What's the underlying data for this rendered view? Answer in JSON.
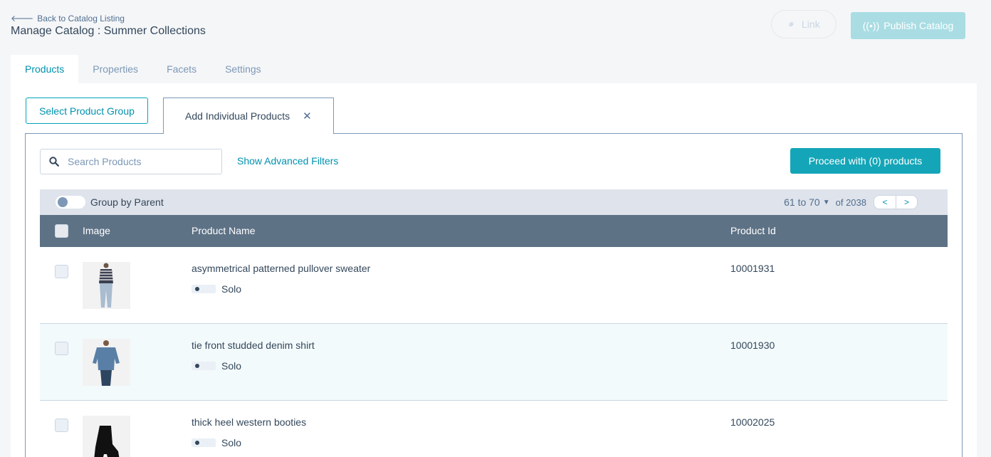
{
  "header": {
    "back_label": "Back to Catalog Listing",
    "title": "Manage Catalog : Summer Collections",
    "link_label": "Link",
    "publish_label": "Publish Catalog",
    "publish_icon": "((•))"
  },
  "tabs": [
    {
      "label": "Products",
      "active": true
    },
    {
      "label": "Properties"
    },
    {
      "label": "Facets"
    },
    {
      "label": "Settings"
    }
  ],
  "product_section": {
    "select_group_label": "Select Product Group",
    "add_individual_label": "Add Individual Products",
    "close_glyph": "✕",
    "search_placeholder": "Search Products",
    "advanced_filters_label": "Show Advanced Filters",
    "proceed_label": "Proceed with (0) products"
  },
  "toolbar": {
    "group_by_label": "Group by Parent",
    "range_label": "61 to 70",
    "of_label": "of 2038",
    "prev": "<",
    "next": ">"
  },
  "table": {
    "columns": [
      "Image",
      "Product Name",
      "Product Id"
    ],
    "rows": [
      {
        "name": "asymmetrical patterned pullover sweater",
        "badge": "Solo",
        "id": "10001931"
      },
      {
        "name": "tie front studded denim shirt",
        "badge": "Solo",
        "id": "10001930"
      },
      {
        "name": "thick heel western booties",
        "badge": "Solo",
        "id": "10002025"
      }
    ]
  },
  "colors": {
    "accent": "#0091ae",
    "primary_button": "#14a6b8",
    "table_header": "#5e7286"
  }
}
